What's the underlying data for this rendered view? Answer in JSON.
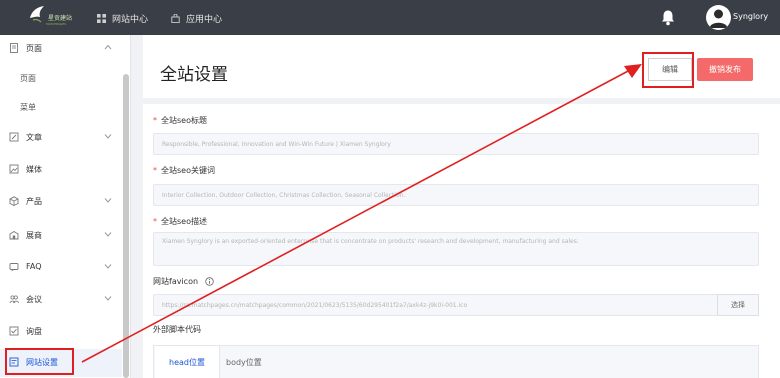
{
  "topbar": {
    "logo_text": "星贡建站",
    "logo_sub": "MATCHPAGES",
    "nav": [
      {
        "label": "网站中心",
        "icon": "grid-icon"
      },
      {
        "label": "应用中心",
        "icon": "bag-icon"
      }
    ],
    "username": "Synglory"
  },
  "sidebar": {
    "items": [
      {
        "label": "页面",
        "icon": "page-icon",
        "expanded": true,
        "children": [
          "页面",
          "菜单"
        ]
      },
      {
        "label": "文章",
        "icon": "article-icon"
      },
      {
        "label": "媒体",
        "icon": "media-icon"
      },
      {
        "label": "产品",
        "icon": "product-icon"
      },
      {
        "label": "展商",
        "icon": "exhibitor-icon"
      },
      {
        "label": "FAQ",
        "icon": "faq-icon"
      },
      {
        "label": "会议",
        "icon": "meeting-icon"
      },
      {
        "label": "询盘",
        "icon": "inquiry-icon"
      },
      {
        "label": "网站设置",
        "icon": "settings-icon",
        "active": true
      }
    ]
  },
  "main": {
    "title": "全站设置",
    "edit_label": "编辑",
    "revoke_label": "撤销发布",
    "fields": {
      "seo_title": {
        "label": "全站seo标题",
        "required": true,
        "value": "Responsible, Professional, Innovation and Win-Win Future | Xiamen Synglory"
      },
      "seo_keywords": {
        "label": "全站seo关键词",
        "required": true,
        "value": "Interior Collection, Outdoor Collection, Christmas Collection, Seasonal Collection."
      },
      "seo_description": {
        "label": "全站seo描述",
        "required": true,
        "value": "Xiamen Synglory is an exported-oriented enterprise that is concentrate on products' research and development, manufacturing and sales."
      },
      "favicon": {
        "label": "网站favicon",
        "value": "https://ss.matchpages.cn/matchpages/common/2021/0623/5135/60d295401f2a7/axk4z-j9k0i-001.ico",
        "choose_label": "选择"
      },
      "script": {
        "label": "外部脚本代码",
        "tabs": [
          "head位置",
          "body位置"
        ]
      }
    }
  },
  "colors": {
    "topbar": "#3a3f47",
    "accent": "#1a56d6",
    "danger": "#f46a6a",
    "annotation": "#e02020"
  }
}
